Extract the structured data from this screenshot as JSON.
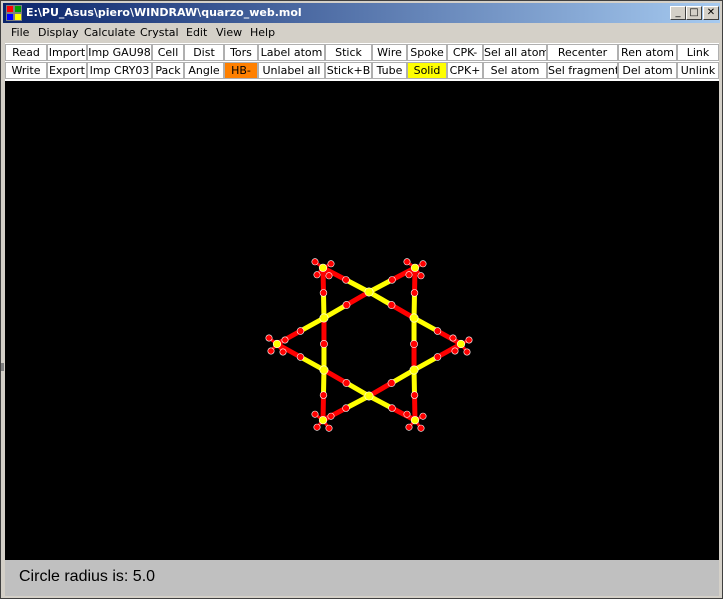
{
  "window": {
    "title": "E:\\PU_Asus\\piero\\WINDRAW\\quarzo_web.mol",
    "controls": {
      "minimize": "_",
      "maximize": "□",
      "close": "✕"
    }
  },
  "menu": [
    "File",
    "Display",
    "Calculate",
    "Crystal",
    "Edit",
    "View",
    "Help"
  ],
  "toolbar": {
    "row1": [
      "Read",
      "Import",
      "Imp GAU98",
      "Cell",
      "Dist",
      "Tors",
      "Label atom",
      "Stick",
      "Wire",
      "Spoke",
      "CPK-",
      "Sel all atom",
      "Recenter",
      "Ren atom",
      "Link"
    ],
    "row2": [
      "Write",
      "Export",
      "Imp CRY03",
      "Pack",
      "Angle",
      "HB-",
      "Unlabel all",
      "Stick+B",
      "Tube",
      "Solid",
      "CPK+",
      "Sel atom",
      "Sel fragment",
      "Del atom",
      "Unlink"
    ],
    "active": {
      "HB-": "#ff8000",
      "Solid": "#ffff00"
    }
  },
  "viewer": {
    "background": "#000000",
    "atom_colors": {
      "oxygen": "#ff0000",
      "silicon": "#ffff00",
      "edge": "#ffffff"
    },
    "display_mode": "Solid"
  },
  "status": {
    "text": "Circle radius is: 5.0"
  }
}
